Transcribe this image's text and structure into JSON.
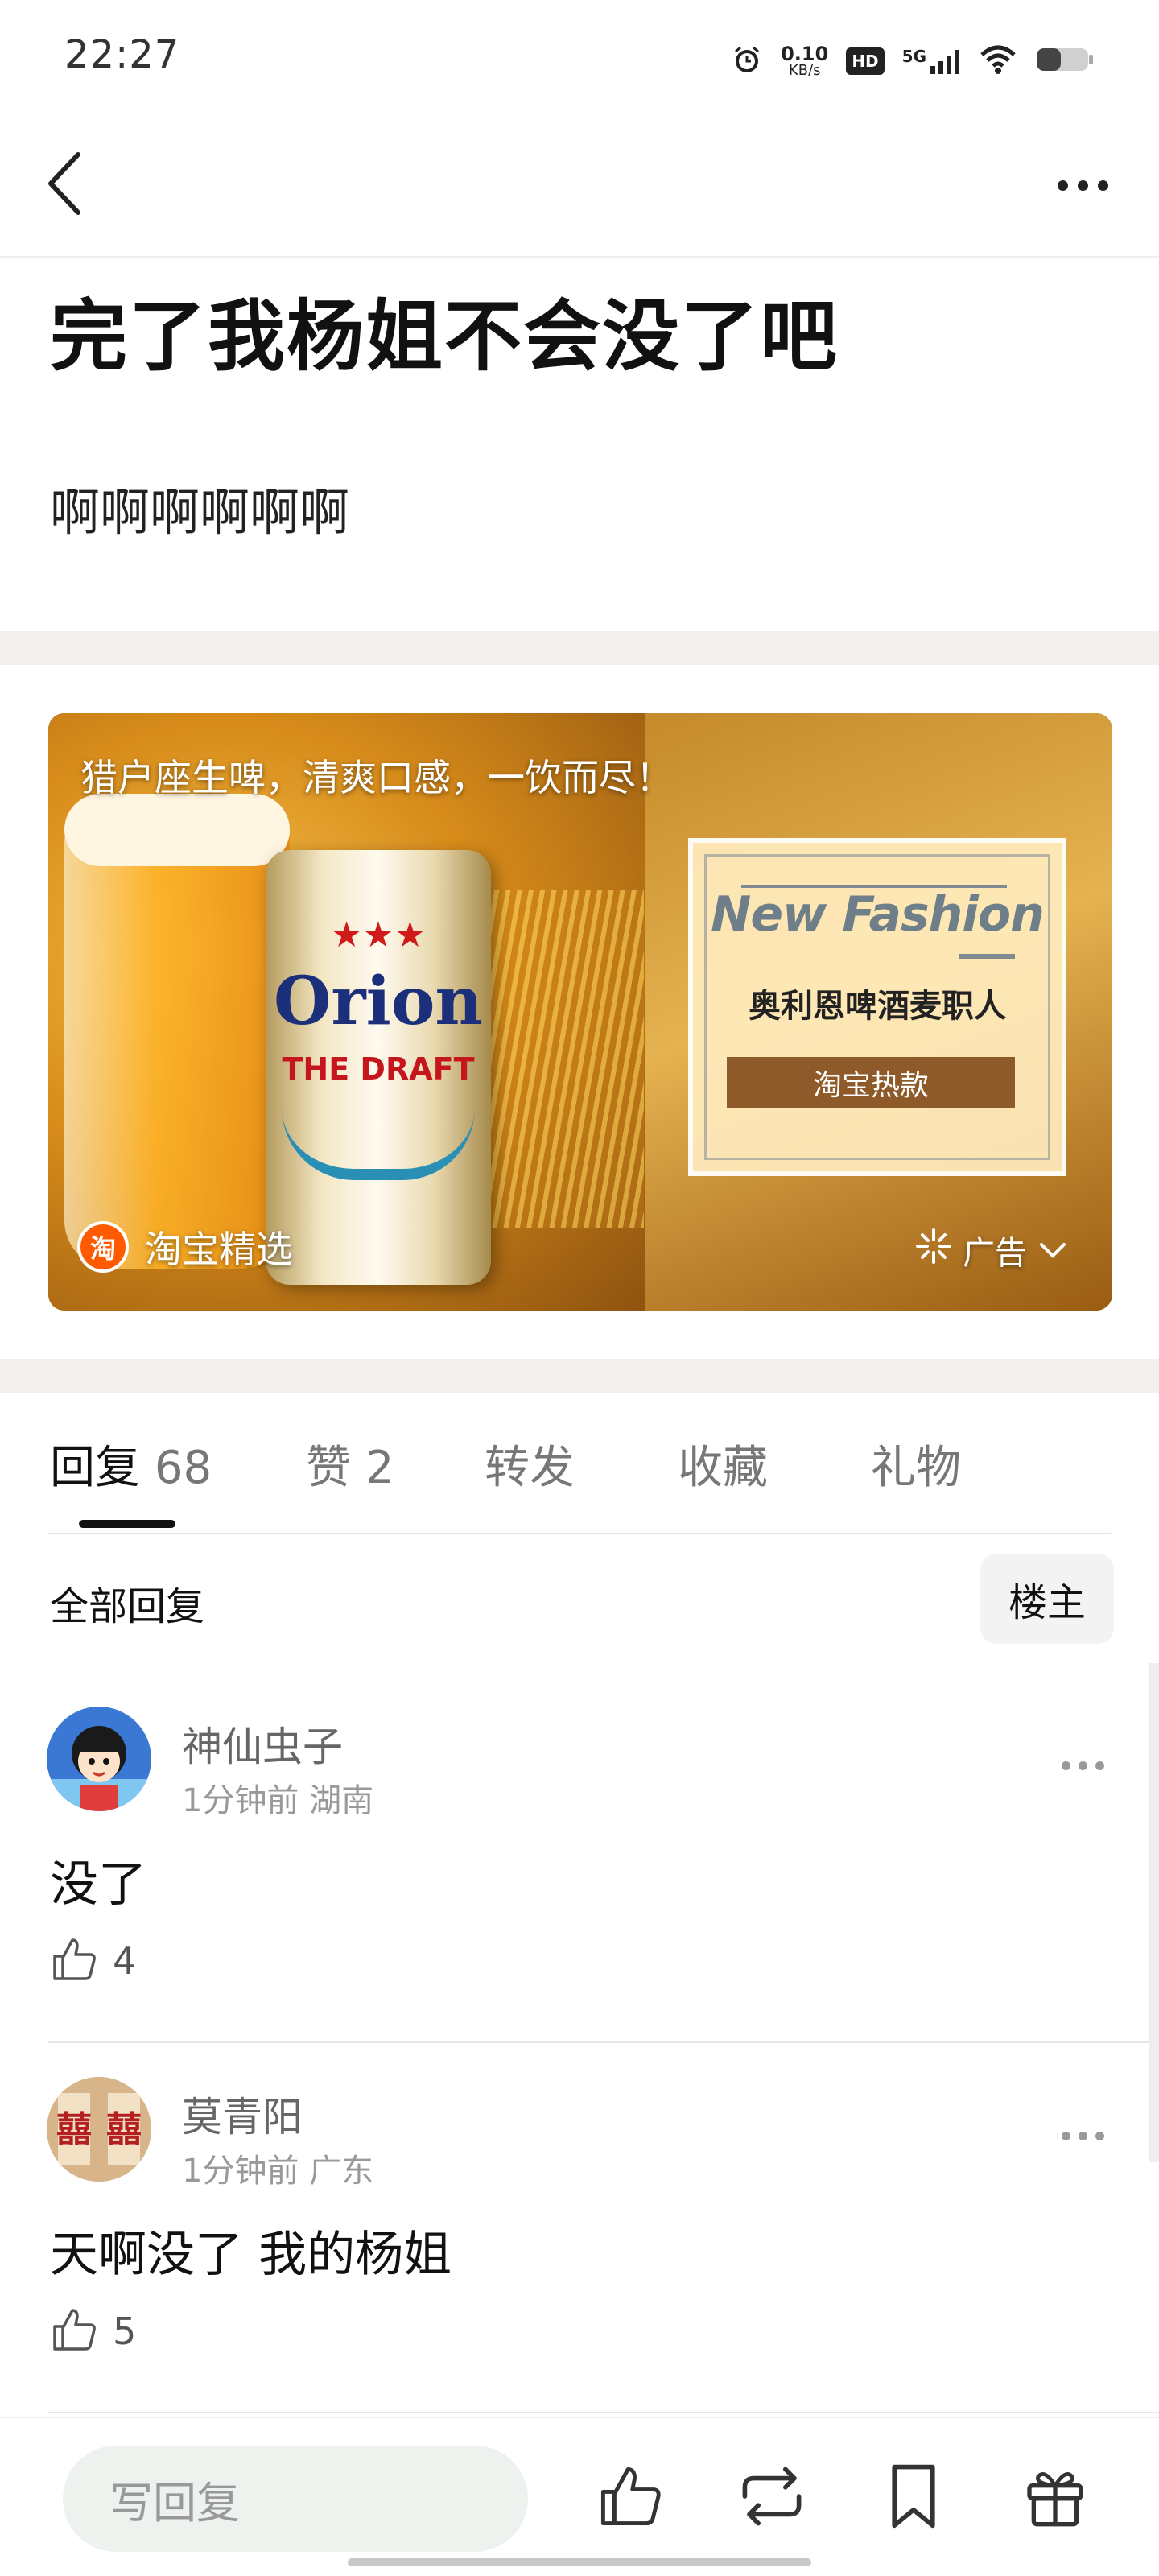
{
  "status_bar": {
    "time": "22:27",
    "net_speed": "0.10",
    "net_unit": "KB/s",
    "hd": "HD",
    "network": "5G",
    "icons": [
      "alarm-icon",
      "hd-icon",
      "5g-signal-icon",
      "wifi-icon",
      "battery-icon"
    ]
  },
  "nav": {
    "back_icon": "chevron-left-icon",
    "more_icon": "more-dots-icon"
  },
  "post": {
    "title": "完了我杨姐不会没了吧",
    "body": "啊啊啊啊啊啊"
  },
  "ad": {
    "caption": "猎户座生啤，清爽口感，一饮而尽！",
    "can_brand": "Orion",
    "can_sub": "THE DRAFT",
    "fashion_label": "New Fashion",
    "product": "奥利恩啤酒麦职人",
    "hot_button": "淘宝热款",
    "source_icon_char": "淘",
    "source": "淘宝精选",
    "tag": "广告"
  },
  "tabs": [
    {
      "label": "回复",
      "count": "68",
      "active": true
    },
    {
      "label": "赞",
      "count": "2",
      "active": false
    },
    {
      "label": "转发",
      "count": "",
      "active": false
    },
    {
      "label": "收藏",
      "count": "",
      "active": false
    },
    {
      "label": "礼物",
      "count": "",
      "active": false
    }
  ],
  "filter": {
    "all_replies": "全部回复",
    "owner_only": "楼主"
  },
  "comments": [
    {
      "name": "神仙虫子",
      "time": "1分钟前",
      "location": "湖南",
      "text": "没了",
      "likes": "4"
    },
    {
      "name": "莫青阳",
      "time": "1分钟前",
      "location": "广东",
      "text": "天啊没了 我的杨姐",
      "likes": "5"
    }
  ],
  "bottom_bar": {
    "reply_placeholder": "写回复",
    "icons": [
      "like-icon",
      "repost-icon",
      "bookmark-icon",
      "gift-icon"
    ]
  }
}
